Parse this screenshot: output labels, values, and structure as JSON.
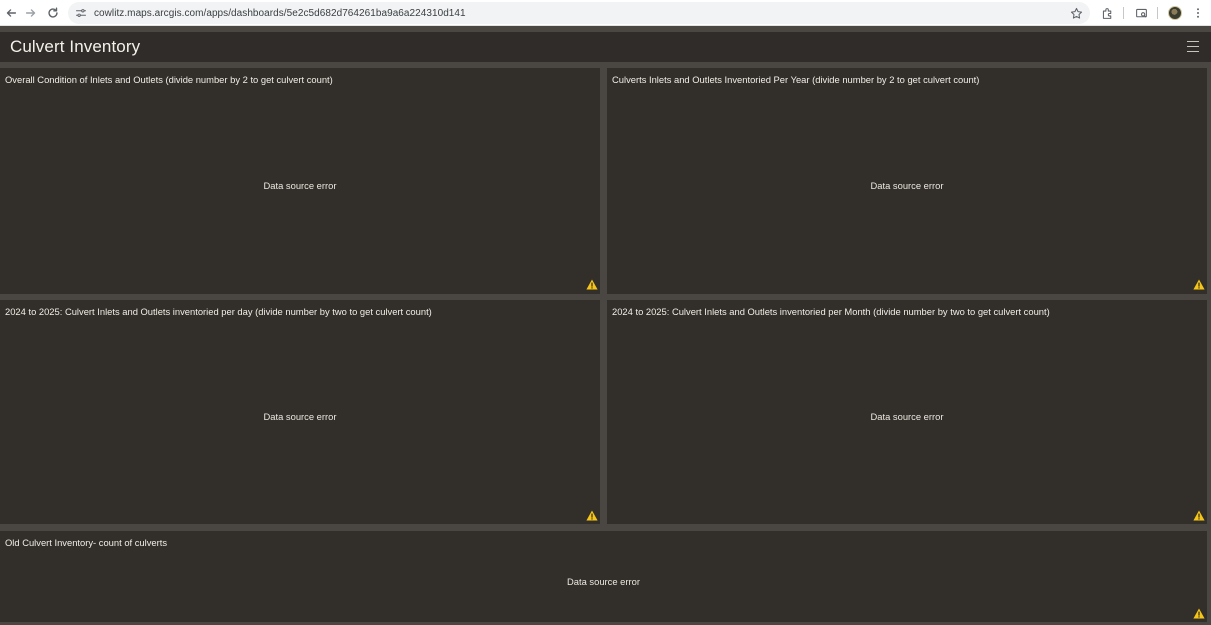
{
  "browser": {
    "url": "cowlitz.maps.arcgis.com/apps/dashboards/5e2c5d682d764261ba9a6a224310d141",
    "icons": [
      "back-arrow-icon",
      "forward-arrow-icon",
      "reload-icon",
      "site-settings-icon",
      "bookmark-star-icon",
      "extensions-icon",
      "cast-icon",
      "profile-avatar",
      "more-vert-icon"
    ]
  },
  "dashboard": {
    "title": "Culvert Inventory",
    "menu_icon": "hamburger-menu-icon"
  },
  "panels": [
    {
      "title": "Overall Condition of Inlets and Outlets (divide number by 2 to get culvert count)",
      "status": "Data source error",
      "status_icon": "warning-icon"
    },
    {
      "title": "Culverts Inlets and Outlets Inventoried Per Year (divide number by 2 to get culvert count)",
      "status": "Data source error",
      "status_icon": "warning-icon"
    },
    {
      "title": "2024 to 2025: Culvert Inlets and Outlets inventoried per day (divide number by two to get culvert count)",
      "status": "Data source error",
      "status_icon": "warning-icon"
    },
    {
      "title": "2024 to 2025: Culvert Inlets and Outlets inventoried per Month (divide number by two to get culvert count)",
      "status": "Data source error",
      "status_icon": "warning-icon"
    },
    {
      "title": "Old Culvert Inventory- count of culverts",
      "status": "Data source error",
      "status_icon": "warning-icon"
    }
  ],
  "colors": {
    "panel_bg": "#322e2a",
    "header_bg": "#2f2c29",
    "page_bg": "#4a4641",
    "warning": "#f5c518"
  }
}
